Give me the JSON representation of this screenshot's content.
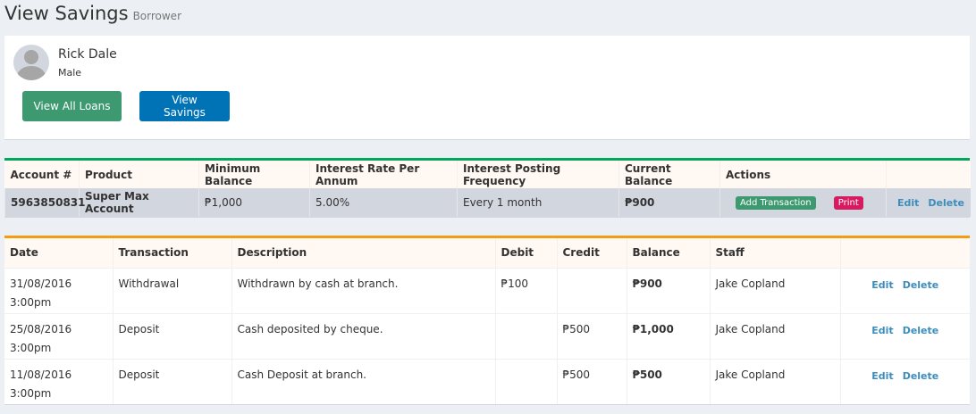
{
  "header": {
    "title": "View Savings",
    "subtitle": "Borrower"
  },
  "profile": {
    "name": "Rick Dale",
    "gender": "Male",
    "buttons": {
      "view_loans": "View All Loans",
      "view_savings": "View Savings"
    }
  },
  "savings_table": {
    "headers": [
      "Account #",
      "Product",
      "Minimum Balance",
      "Interest Rate Per Annum",
      "Interest Posting Frequency",
      "Current Balance",
      "Actions",
      ""
    ],
    "row": {
      "account": "5963850831",
      "product": "Super Max Account",
      "min_balance": "₱1,000",
      "interest_rate": "5.00%",
      "posting_frequency": "Every 1 month",
      "current_balance": "₱900",
      "add_transaction": "Add Transaction",
      "print": "Print",
      "edit": "Edit",
      "delete": "Delete"
    }
  },
  "transactions_table": {
    "headers": [
      "Date",
      "Transaction",
      "Description",
      "Debit",
      "Credit",
      "Balance",
      "Staff",
      ""
    ],
    "rows": [
      {
        "date": "31/08/2016",
        "time": "3:00pm",
        "transaction": "Withdrawal",
        "description": "Withdrawn by cash at branch.",
        "debit": "₱100",
        "credit": "",
        "balance": "₱900",
        "staff": "Jake Copland",
        "edit": "Edit",
        "delete": "Delete"
      },
      {
        "date": "25/08/2016",
        "time": "3:00pm",
        "transaction": "Deposit",
        "description": "Cash deposited by cheque.",
        "debit": "",
        "credit": "₱500",
        "balance": "₱1,000",
        "staff": "Jake Copland",
        "edit": "Edit",
        "delete": "Delete"
      },
      {
        "date": "11/08/2016",
        "time": "3:00pm",
        "transaction": "Deposit",
        "description": "Cash Deposit at branch.",
        "debit": "",
        "credit": "₱500",
        "balance": "₱500",
        "staff": "Jake Copland",
        "edit": "Edit",
        "delete": "Delete"
      }
    ]
  },
  "colors": {
    "savings_border": "#00a65a",
    "transactions_border": "#f39c12",
    "green_button": "#3d9970",
    "blue_button": "#0073b7",
    "print_label": "#d81b60",
    "link": "#3c8dbc"
  }
}
